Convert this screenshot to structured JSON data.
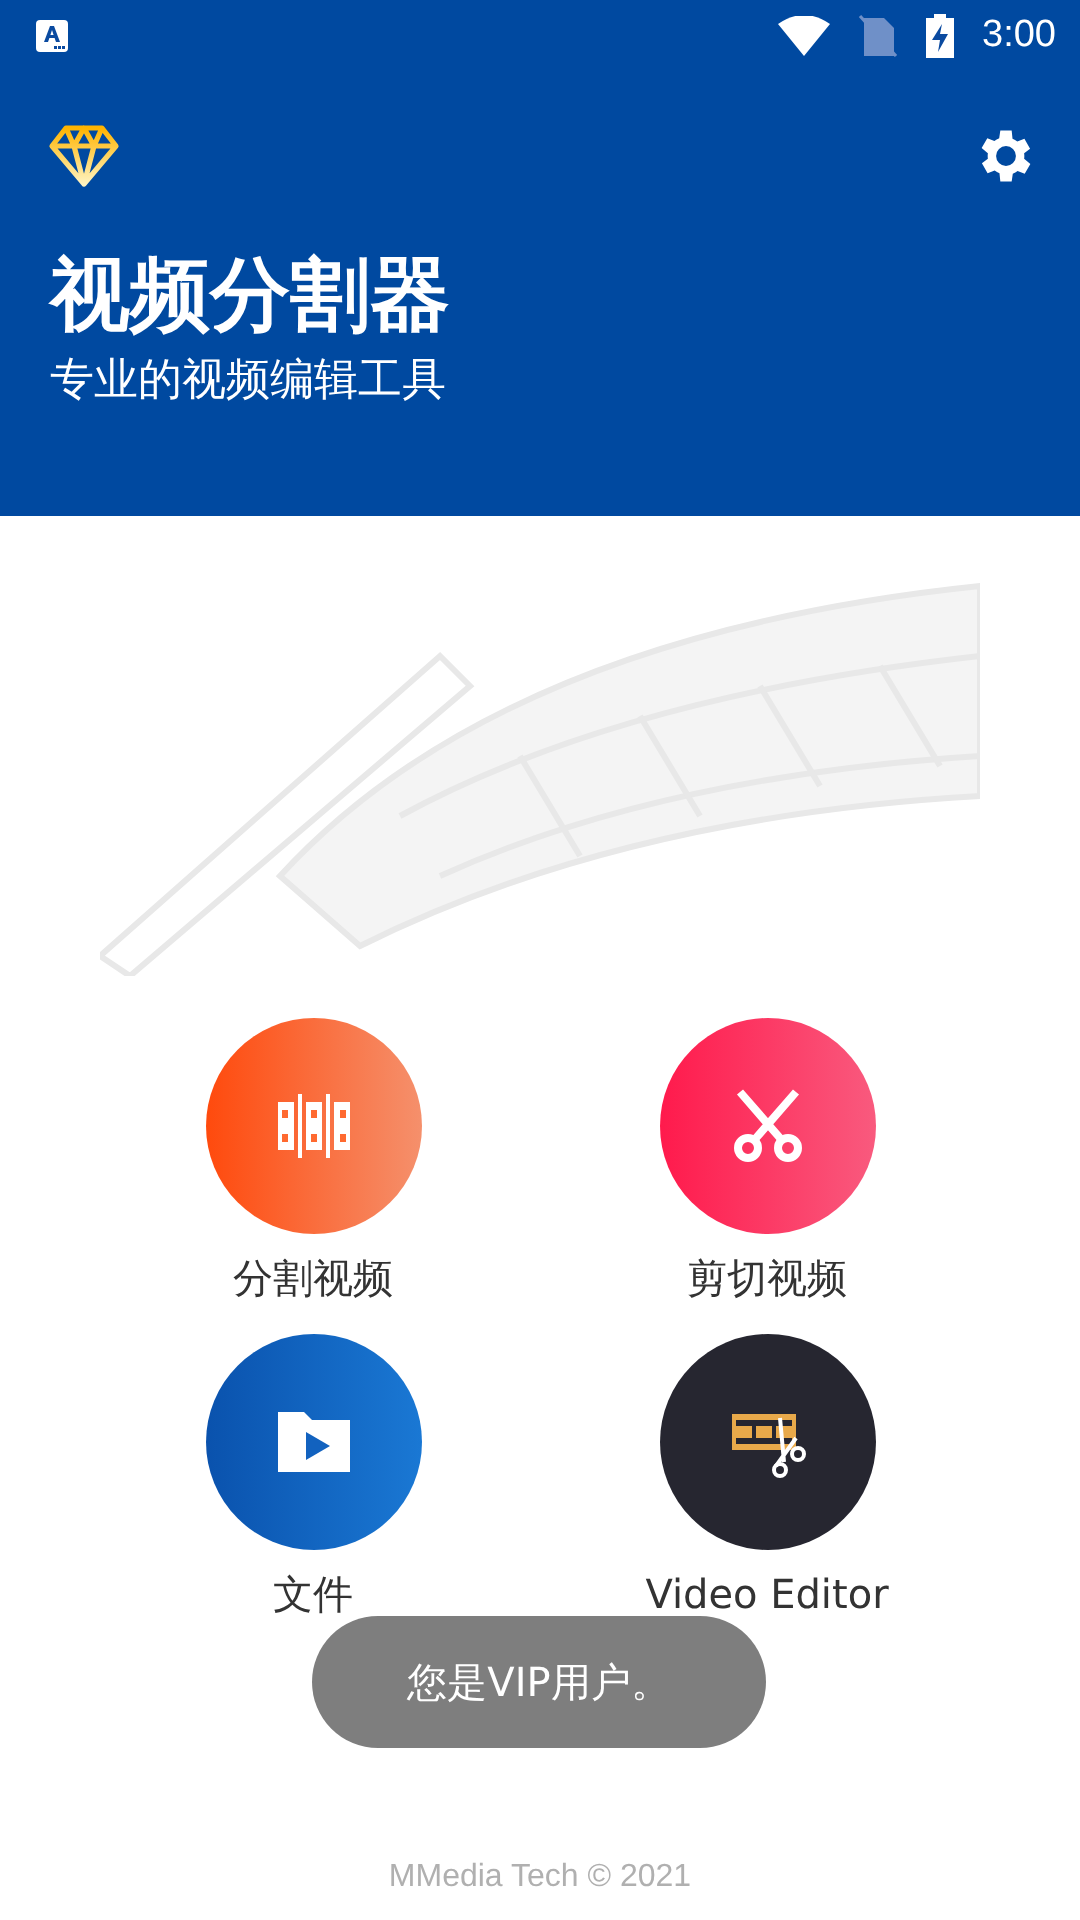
{
  "status_bar": {
    "time": "3:00"
  },
  "header": {
    "title": "视频分割器",
    "subtitle": "专业的视频编辑工具"
  },
  "tools": [
    {
      "kind": "split",
      "label": "分割视频"
    },
    {
      "kind": "cut",
      "label": "剪切视频"
    },
    {
      "kind": "files",
      "label": "文件"
    },
    {
      "kind": "editor",
      "label": "Video Editor"
    }
  ],
  "toast": "您是VIP用户。",
  "footer": "MMedia Tech © 2021"
}
